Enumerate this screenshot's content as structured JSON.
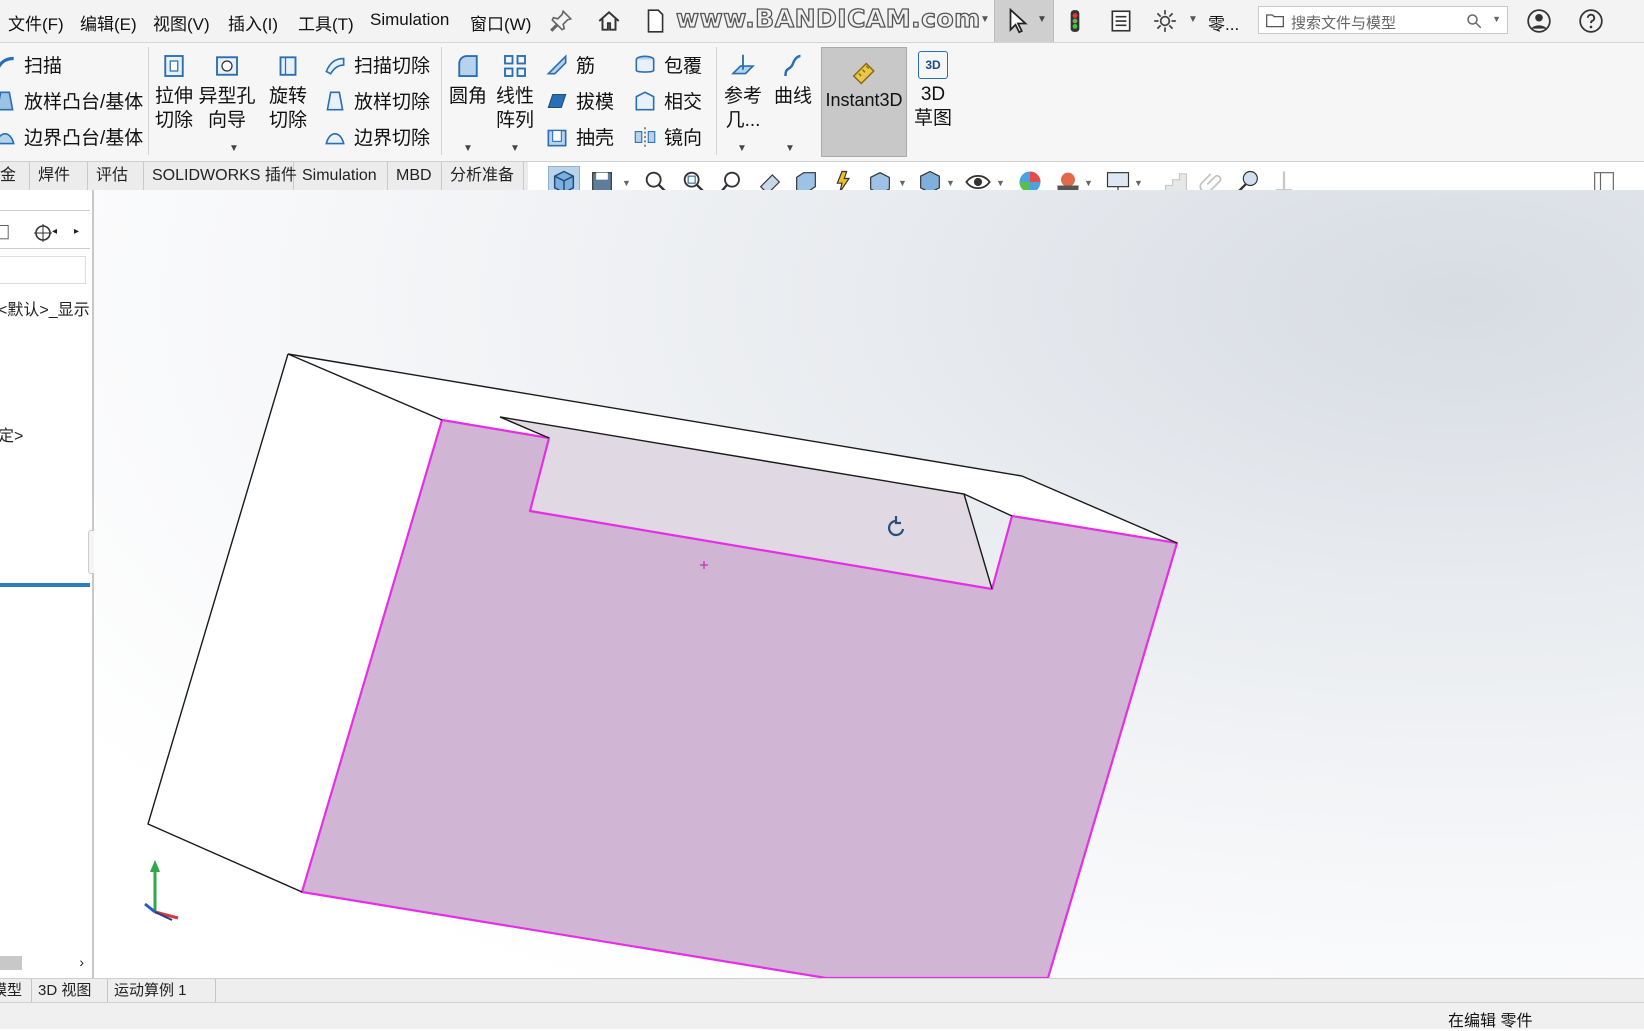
{
  "menu": {
    "items": [
      "文件(F)",
      "编辑(E)",
      "视图(V)",
      "插入(I)",
      "工具(T)",
      "Simulation",
      "窗口(W)"
    ],
    "pin_icon": "pin-icon",
    "part_label": "零...",
    "search_placeholder": "搜索文件与模型"
  },
  "watermark": "www.BANDICAM.com",
  "ribbon": {
    "sweep": "扫描",
    "loft_boss": "放样凸台/基体",
    "boundary_boss": "边界凸台/基体",
    "extrude_cut": [
      "拉伸",
      "切除"
    ],
    "hole_wizard": [
      "异型孔",
      "向导"
    ],
    "revolve_cut": [
      "旋转",
      "切除"
    ],
    "swept_cut": "扫描切除",
    "lofted_cut": "放样切除",
    "boundary_cut": "边界切除",
    "fillet": "圆角",
    "linear_pattern": [
      "线性",
      "阵列"
    ],
    "rib": "筋",
    "draft": "拔模",
    "shell": "抽壳",
    "wrap": "包覆",
    "intersect": "相交",
    "mirror": "镜向",
    "ref_geometry": [
      "参考",
      "几..."
    ],
    "curves": "曲线",
    "instant3d": "Instant3D",
    "sketch3d": [
      "3D",
      "草图"
    ],
    "sketch3d_badge": "3D"
  },
  "tabs": [
    "金",
    "焊件",
    "评估",
    "SOLIDWORKS 插件",
    "Simulation",
    "MBD",
    "分析准备"
  ],
  "left_panel": {
    "config_text": "<默认>_显示",
    "item2": "定>"
  },
  "bottom_tabs": [
    "模型",
    "3D 视图",
    "运动算例 1"
  ],
  "status": "在编辑 零件",
  "colors": {
    "face_fill": "#d1b5d5",
    "face_edge": "#e62ee6",
    "body_edge": "#1a1a1a",
    "accent": "#2f7cc0"
  }
}
